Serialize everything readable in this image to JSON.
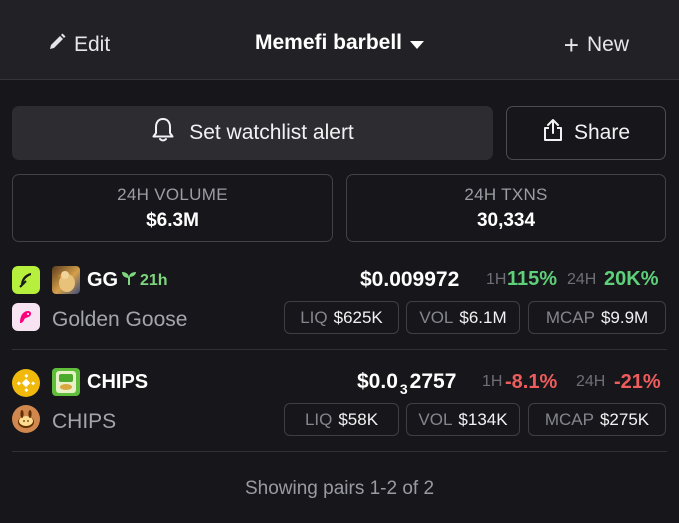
{
  "header": {
    "edit_label": "Edit",
    "title": "Memefi barbell",
    "new_label": "New"
  },
  "actions": {
    "alert_label": "Set watchlist alert",
    "share_label": "Share"
  },
  "stats": {
    "volume_label": "24H VOLUME",
    "volume_value": "$6.3M",
    "txns_label": "24H TXNS",
    "txns_value": "30,334"
  },
  "pairs": [
    {
      "symbol": "GG",
      "age": "21h",
      "name": "Golden Goose",
      "price": "$0.009972",
      "change_1h_label": "1H",
      "change_1h": "115%",
      "change_24h_label": "24H",
      "change_24h": "20K%",
      "liq_label": "LIQ",
      "liq": "$625K",
      "vol_label": "VOL",
      "vol": "$6.1M",
      "mcap_label": "MCAP",
      "mcap": "$9.9M",
      "colors": {
        "chain": "#b6f03c",
        "dex": "#f7e3f2"
      }
    },
    {
      "symbol": "CHIPS",
      "name": "CHIPS",
      "price_prefix": "$0.0",
      "price_sub": "3",
      "price_suffix": "2757",
      "change_1h_label": "1H",
      "change_1h": "-8.1%",
      "change_24h_label": "24H",
      "change_24h": "-21%",
      "liq_label": "LIQ",
      "liq": "$58K",
      "vol_label": "VOL",
      "vol": "$134K",
      "mcap_label": "MCAP",
      "mcap": "$275K",
      "colors": {
        "chain": "#f0b90b",
        "dex": "#d1884f"
      }
    }
  ],
  "footer": {
    "text": "Showing pairs 1-2 of 2"
  },
  "theme": {
    "background": "#17171b",
    "positive": "#5fd07a",
    "negative": "#ef5c5c"
  }
}
